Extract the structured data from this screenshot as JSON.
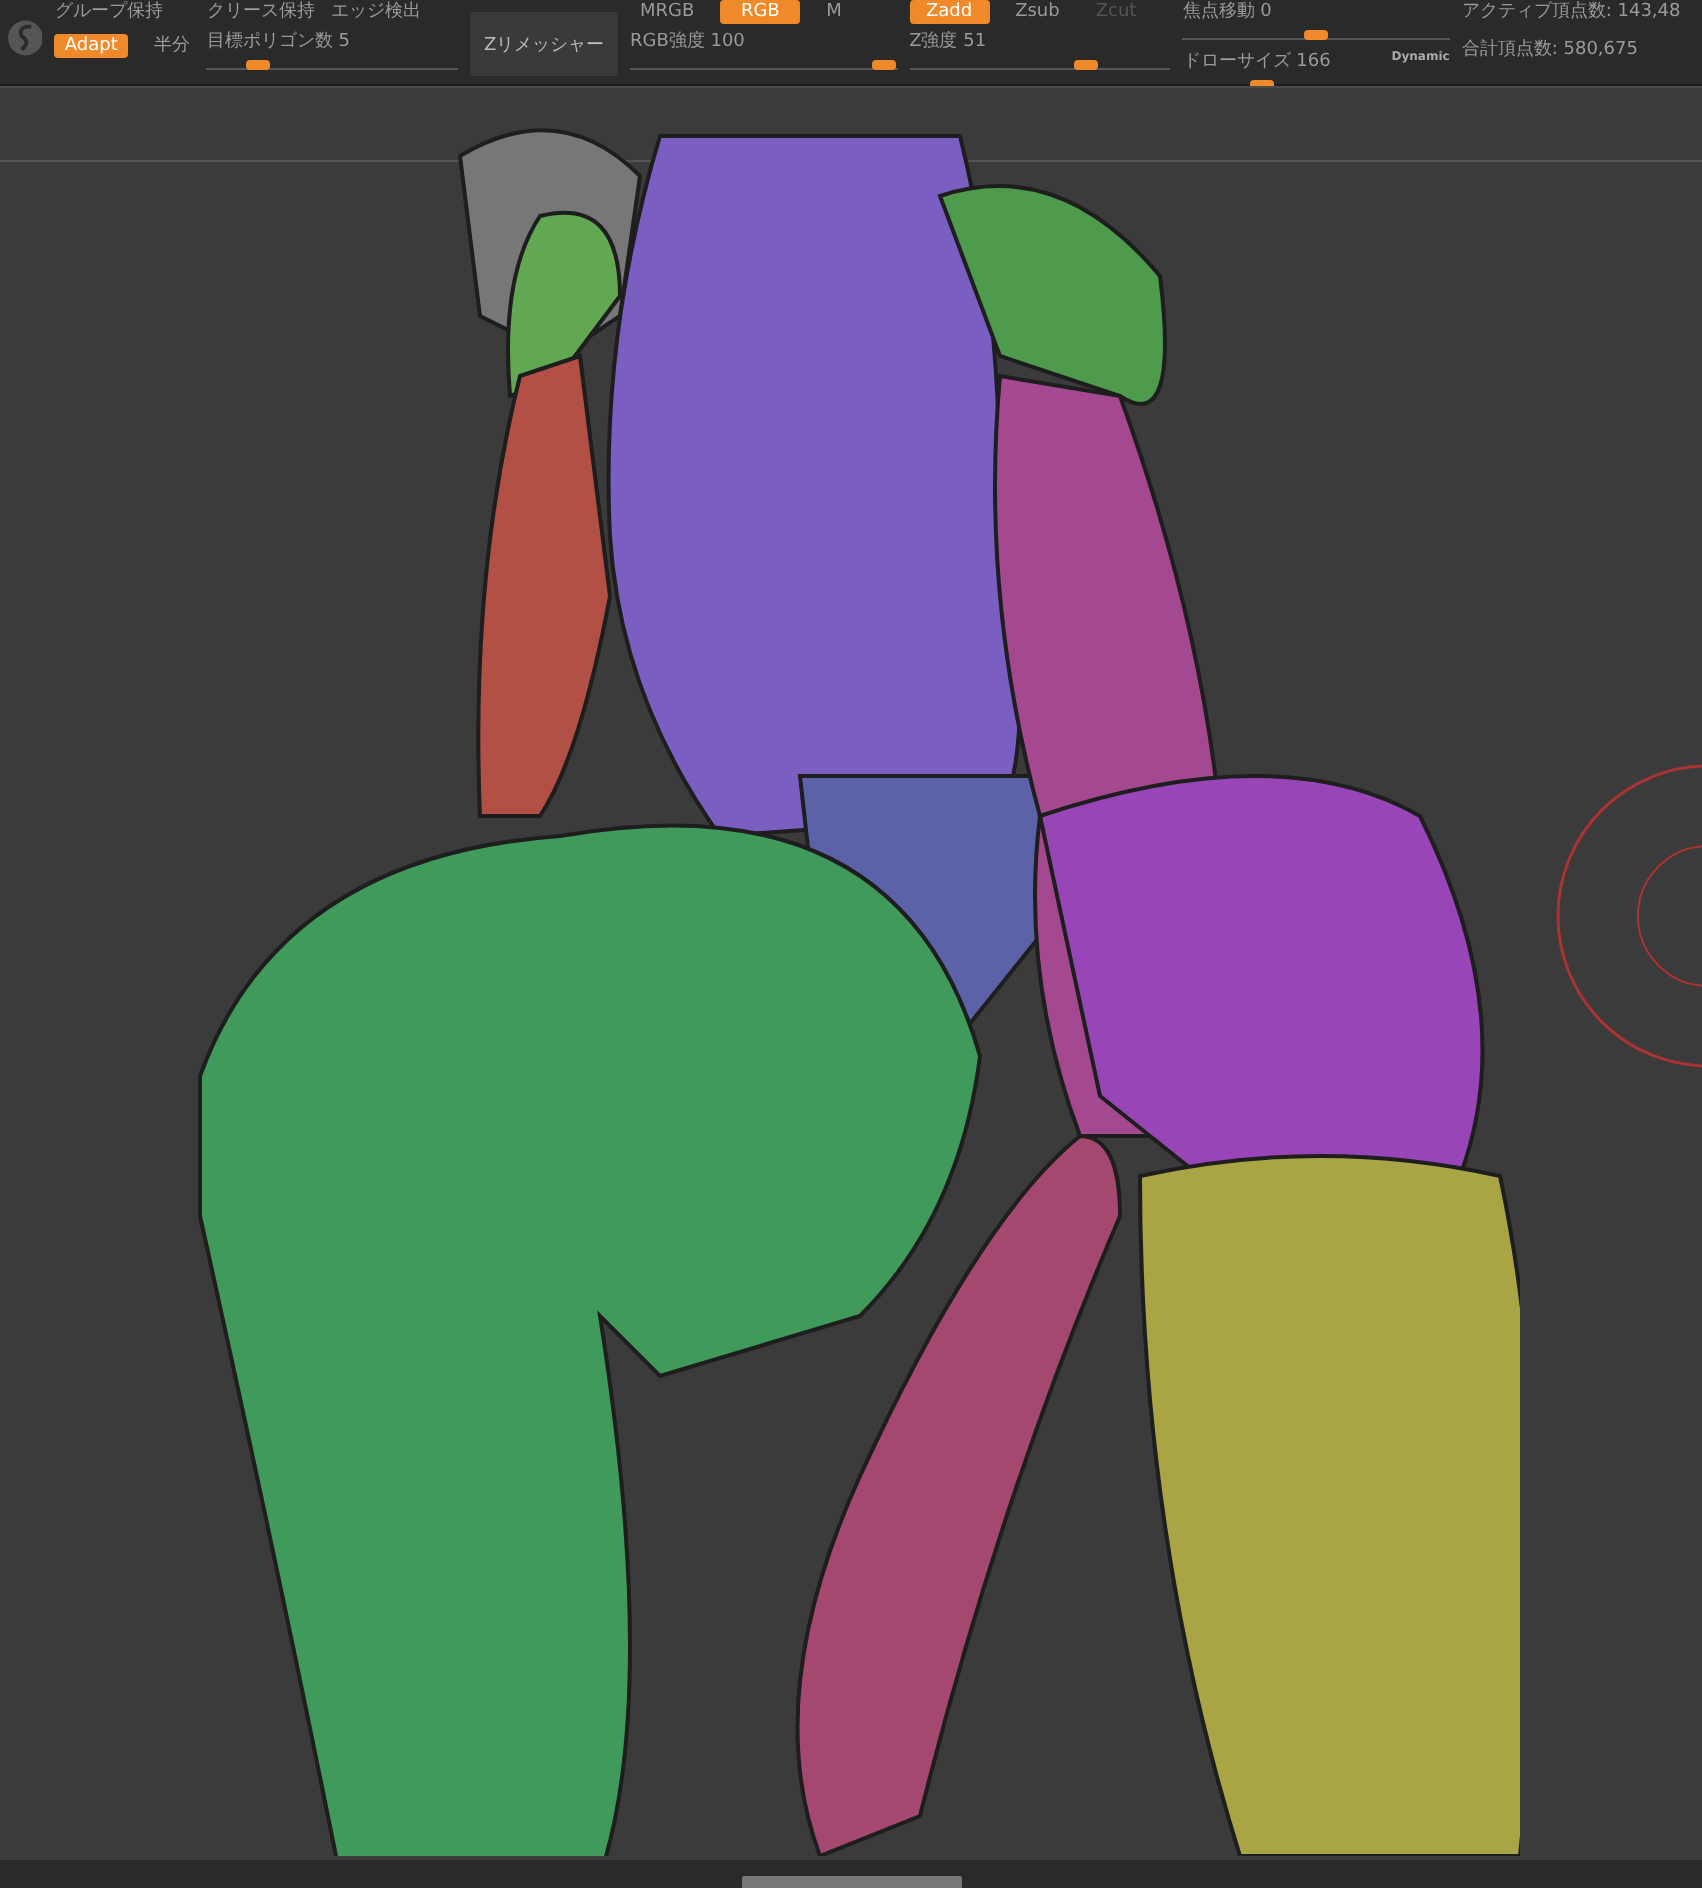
{
  "toolbar": {
    "options": [
      {
        "label": "グループ保持"
      },
      {
        "label": "クリース保持"
      },
      {
        "label": "エッジ検出"
      }
    ],
    "mode_toggles": [
      {
        "label": "Adapt",
        "selected": true
      },
      {
        "label": "半分",
        "selected": false
      }
    ],
    "target_polygons": {
      "label": "目標ポリゴン数 5",
      "level": 0.2
    },
    "remesher_button": "Zリメッシャー",
    "color_modes": [
      {
        "label": "MRGB",
        "selected": false
      },
      {
        "label": "RGB",
        "selected": true
      },
      {
        "label": "M",
        "selected": false
      }
    ],
    "rgb_intensity": {
      "label": "RGB強度 100",
      "level": 0.95
    },
    "depth_modes": [
      {
        "label": "Zadd",
        "selected": true,
        "disabled": false
      },
      {
        "label": "Zsub",
        "selected": false,
        "disabled": false
      },
      {
        "label": "Zcut",
        "selected": false,
        "disabled": true
      }
    ],
    "z_intensity": {
      "label": "Z強度 51",
      "level": 0.68
    },
    "focal_shift": {
      "label": "焦点移動 0",
      "level": 0.5
    },
    "draw_size": {
      "label": "ドローサイズ 166",
      "level": 0.4
    },
    "dynamic_label": "Dynamic",
    "active_points": "アクティブ頂点数: 143,48",
    "total_points": "合計頂点数: 580,675"
  }
}
